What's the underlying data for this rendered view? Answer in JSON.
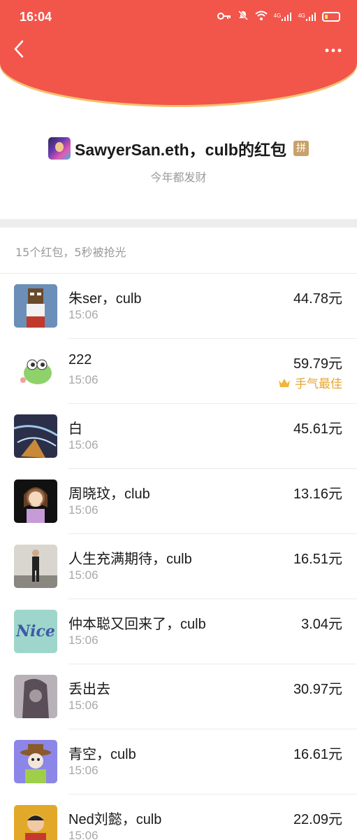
{
  "status_bar": {
    "time": "16:04",
    "icons": [
      "key-icon",
      "mute-icon",
      "wifi-icon",
      "signal-4g-icon",
      "signal-4g-icon",
      "battery-icon"
    ],
    "signal_label_1": "4G",
    "signal_label_2": "4G"
  },
  "header": {
    "back_icon": "‹",
    "more_icon": "•••",
    "colors": {
      "red": "#f2554a",
      "gold": "#f4c170"
    }
  },
  "title": {
    "text": "SawyerSan.eth，culb的红包",
    "badge": "拼",
    "subtitle": "今年都发财"
  },
  "summary": "15个红包，5秒被抢光",
  "list": [
    {
      "name": "朱ser，culb",
      "time": "15:06",
      "amount": "44.78元",
      "best": ""
    },
    {
      "name": "222",
      "time": "15:06",
      "amount": "59.79元",
      "best": "手气最佳"
    },
    {
      "name": "白",
      "time": "15:06",
      "amount": "45.61元",
      "best": ""
    },
    {
      "name": "周晓玟，club",
      "time": "15:06",
      "amount": "13.16元",
      "best": ""
    },
    {
      "name": "人生充满期待，culb",
      "time": "15:06",
      "amount": "16.51元",
      "best": ""
    },
    {
      "name": "仲本聪又回来了，culb",
      "time": "15:06",
      "amount": "3.04元",
      "best": ""
    },
    {
      "name": "丢出去",
      "time": "15:06",
      "amount": "30.97元",
      "best": ""
    },
    {
      "name": "青空，culb",
      "time": "15:06",
      "amount": "16.61元",
      "best": ""
    },
    {
      "name": "Ned刘懿，culb",
      "time": "15:06",
      "amount": "22.09元",
      "best": ""
    }
  ],
  "avatar_nice_text": "Nice"
}
